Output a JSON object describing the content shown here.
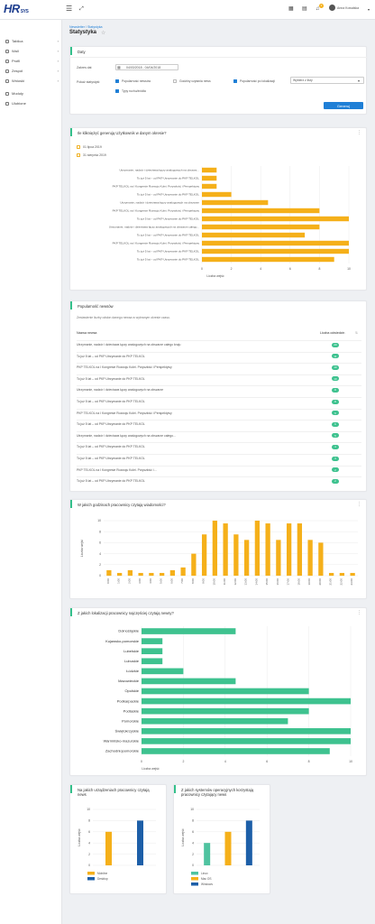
{
  "app": {
    "logo": "HR",
    "logo_sub": "SYS",
    "user": "Anna Kowalska"
  },
  "topbar": {
    "notif_count": "3"
  },
  "sidebar": {
    "items": [
      {
        "label": "Tablica",
        "arrow": true
      },
      {
        "label": "Wall",
        "arrow": true
      },
      {
        "label": "Profil",
        "arrow": true
      },
      {
        "label": "Zespół",
        "arrow": true
      },
      {
        "label": "Wnioski",
        "arrow": true
      },
      {
        "label": "Moduły",
        "arrow": false
      },
      {
        "label": "Ulubione",
        "arrow": false
      }
    ]
  },
  "breadcrumb": "Newsletter / Statystyka",
  "page_title": "Statystyka",
  "dates_card": {
    "title": "Daty",
    "range_label": "Zakres dat",
    "range_value": "04/03/2018 - 04/04/2018",
    "show_label": "Pokaż statystyki:",
    "options": [
      {
        "label": "Popularność newsów",
        "checked": true
      },
      {
        "label": "Godziny czytania news",
        "checked": false
      },
      {
        "label": "Popularność po lokalizacji",
        "checked": true
      },
      {
        "label": "Typy ruchu/źródła",
        "checked": true
      }
    ],
    "select_placeholder": "Wybierz z listy",
    "generate_label": "Generuj"
  },
  "users_card": {
    "title": "Ile klikniężęć generują Użytkownik w danym okresie?",
    "legend": [
      "01 lipca 2019",
      "31 sierpnia 2019"
    ],
    "xlabel": "Liczba wejść"
  },
  "news_table": {
    "title": "Popularność newsów",
    "subtitle": "Zestawienie liczby odsłon danego newsa w wybranym okresie czasu.",
    "col_name": "Nazwa newsa",
    "col_count": "Liczba odwiedzin",
    "rows": [
      {
        "name": "Utrzymanie, nadzór i dzierżawa łączy analogowych na obszarze całego kraju",
        "count": "20"
      },
      {
        "name": "To już 5 lat – od PKP Utrzymanie do PKP TELKOL",
        "count": "11"
      },
      {
        "name": "PKP TELKOL na I Kongresie Rozwoju Kolei. Przyszłość i Perspektywy",
        "count": "10"
      },
      {
        "name": "To już 5 lat – od PKP Utrzymanie do PKP TELKOL",
        "count": "10"
      },
      {
        "name": "Utrzymanie, nadzór i dzierżawa łączy analogowych na obszarze",
        "count": "8"
      },
      {
        "name": "To już 5 lat – od PKP Utrzymanie do PKP TELKOL",
        "count": "8"
      },
      {
        "name": "PKP TELKOL na I Kongresie Rozwoju Kolei. Przyszłość i Perspektywy",
        "count": "6"
      },
      {
        "name": "To już 5 lat – od PKP Utrzymanie do PKP TELKOL",
        "count": "6"
      },
      {
        "name": "Utrzymanie, nadzór i dzierżawa łączy analogowych na obszarze całego...",
        "count": "5"
      },
      {
        "name": "To już 5 lat – od PKP Utrzymanie do PKP TELKOL",
        "count": "4"
      },
      {
        "name": "To już 5 lat – od PKP Utrzymanie do PKP TELKOL",
        "count": "3"
      },
      {
        "name": "PKP TELKOL na I Kongresie Rozwoju Kolei. Przyszłość i ...",
        "count": "2"
      },
      {
        "name": "To już 5 lat – od PKP Utrzymanie do PKP TELKOL",
        "count": "2"
      }
    ]
  },
  "hours_card": {
    "title": "W jakich godzinach pracownicy czytają wiadomości?"
  },
  "loc_card": {
    "title": "Z jakich lokalizacji pracownicy najczęściej czytają newsy?"
  },
  "devices_card": {
    "title": "Na jakich urządzeniach pracownicy czytają news"
  },
  "os_card": {
    "title": "Z jakich systemów operacyjnych korzystają pracownicy czytający news"
  },
  "colors": {
    "accent": "#1f7fd6",
    "orange": "#f5b01a",
    "green": "#3ec28f",
    "blue": "#1d5fa8",
    "teal": "#4fc3a0"
  },
  "chart_data": [
    {
      "type": "bar",
      "orientation": "horizontal",
      "categories": [
        "Utrzymanie, nadzór i dzierżawa łączy analogowych na obszarz...",
        "To już 5 lat – od PKP Utrzymanie do PKP TELKOL",
        "PKP TELKOL na I Kongresie Rozwoju Kolei. Przyszłość i Perspektywy",
        "To już 5 lat – od PKP Utrzymanie do PKP TELKOL",
        "Utrzymanie, nadzór i dzierżawa łączy analogowych na obszarze",
        "PKP TELKOL na I Kongresie Rozwoju Kolei. Przyszłość i Perspektywy",
        "To już 5 lat – od PKP Utrzymanie do PKP TELKOL",
        "Utrzymanie, nadzór i dzierżawa łączy analogowych na obszarze całego...",
        "To już 5 lat – od PKP Utrzymanie do PKP TELKOL",
        "PKP TELKOL na I Kongresie Rozwoju Kolei. Przyszłość i Perspektywy",
        "To już 5 lat – od PKP Utrzymanie do PKP TELKOL"
      ],
      "values": [
        1,
        1,
        1,
        2,
        4.5,
        8,
        10,
        8,
        7,
        10,
        10,
        9
      ],
      "xlim": [
        0,
        10
      ],
      "xticks": [
        0,
        2,
        4,
        6,
        8,
        10
      ],
      "xlabel": "Liczba wejść"
    },
    {
      "type": "bar",
      "categories": [
        "0:00",
        "1:00",
        "2:00",
        "3:00",
        "4:00",
        "5:00",
        "6:00",
        "7:00",
        "8:00",
        "9:00",
        "10:00",
        "11:00",
        "12:00",
        "13:00",
        "14:00",
        "15:00",
        "16:00",
        "17:00",
        "18:00",
        "19:00",
        "20:00",
        "21:00",
        "22:00",
        "23:00"
      ],
      "values": [
        1,
        0.5,
        1,
        0.5,
        0.5,
        0.5,
        1,
        1.5,
        4,
        7.5,
        10,
        9.5,
        7.5,
        6.5,
        10,
        9.5,
        6.5,
        9.5,
        9.5,
        6.5,
        6,
        0.5,
        0.5,
        0.5
      ],
      "ylim": [
        0,
        10
      ],
      "yticks": [
        0,
        2,
        4,
        6,
        8,
        10
      ],
      "ylabel": "Liczba wejść"
    },
    {
      "type": "bar",
      "orientation": "horizontal",
      "categories": [
        "Dolnośląskie",
        "Kujawsko-pomorskie",
        "Lubelskie",
        "Lubuskie",
        "Łódzkie",
        "Mazowieckie",
        "Opolskie",
        "Podkarpackie",
        "Podlaskie",
        "Pomorskie",
        "Świętokrzyskie",
        "Warmińsko-mazurskie",
        "Zachodniopomorskie"
      ],
      "values": [
        4.5,
        1,
        1,
        1,
        2,
        4.5,
        8,
        10,
        8,
        7,
        10,
        10,
        9
      ],
      "xlim": [
        0,
        10
      ],
      "xticks": [
        0,
        2,
        4,
        6,
        8,
        10
      ],
      "xlabel": "Liczba wejść"
    },
    {
      "type": "bar",
      "categories": [
        "Mobilne",
        "Desktop"
      ],
      "values": [
        6,
        8
      ],
      "ylim": [
        0,
        10
      ],
      "yticks": [
        0,
        2,
        4,
        6,
        8,
        10
      ],
      "ylabel": "Liczba wejść",
      "legend": [
        "Mobilne",
        "Desktop"
      ]
    },
    {
      "type": "bar",
      "categories": [
        "Linux",
        "Mac OS",
        "Windows"
      ],
      "values": [
        4,
        6,
        8
      ],
      "ylim": [
        0,
        10
      ],
      "yticks": [
        0,
        2,
        4,
        6,
        8,
        10
      ],
      "ylabel": "Liczba wejść",
      "legend": [
        "Linux",
        "Mac OS",
        "Windows"
      ]
    }
  ]
}
